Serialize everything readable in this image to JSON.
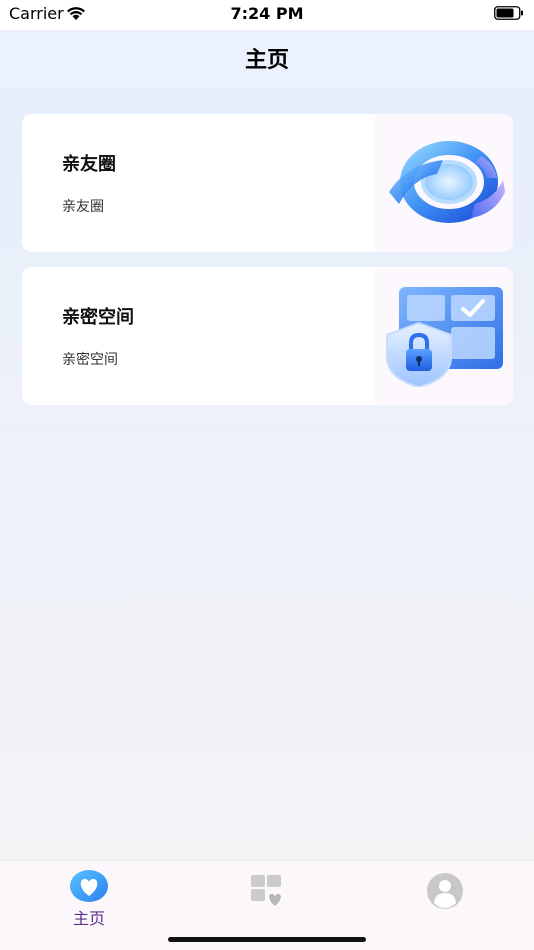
{
  "status_bar": {
    "carrier": "Carrier",
    "time": "7:24 PM"
  },
  "nav": {
    "title": "主页"
  },
  "cards": [
    {
      "title": "亲友圈",
      "subtitle": "亲友圈",
      "icon": "ring-3d-icon"
    },
    {
      "title": "亲密空间",
      "subtitle": "亲密空间",
      "icon": "secure-space-icon"
    }
  ],
  "tabs": [
    {
      "label": "主页",
      "icon": "heart-icon",
      "selected": true
    },
    {
      "label": "",
      "icon": "space-heart-icon",
      "selected": false
    },
    {
      "label": "",
      "icon": "profile-icon",
      "selected": false
    }
  ],
  "colors": {
    "nav_background": "#ebf1fd",
    "tab_active": "#5c2f8a",
    "tab_inactive": "#c8c8c8",
    "accent_blue": "#3d8ef5"
  }
}
